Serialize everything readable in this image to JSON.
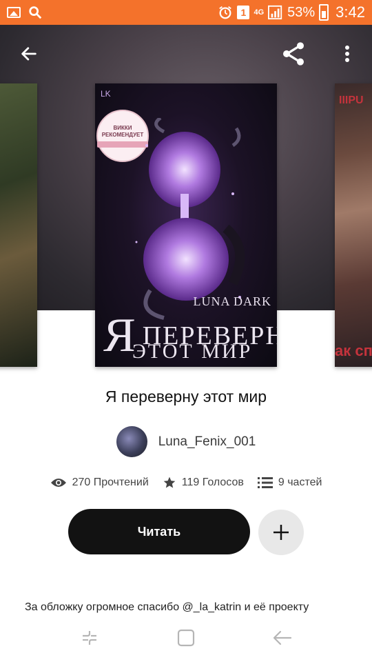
{
  "status_bar": {
    "network_label": "4G",
    "sim_slot": "1",
    "battery_percent": "53%",
    "time": "3:42",
    "icons": [
      "gallery-icon",
      "search-icon",
      "alarm-icon",
      "sim-icon",
      "signal-icon",
      "battery-icon"
    ]
  },
  "header": {
    "icons": [
      "back-arrow-icon",
      "share-icon",
      "more-vert-icon"
    ]
  },
  "cover": {
    "publisher_mark": "LK",
    "badge_text": "ВИККИ РЕКОМЕНДУЕТ",
    "author_line": "LUNA DARK",
    "title_big_letter": "Я",
    "title_line1": "ПЕРЕВЕРНУ",
    "title_line2": "ЭТОТ МИР",
    "right_cover_partial_text": "ак сп",
    "colors": {
      "accent_glow": "#b07ae0"
    }
  },
  "story": {
    "title": "Я переверну этот мир",
    "author": "Luna_Fenix_001",
    "reads": "270 Прочтений",
    "votes": "119 Голосов",
    "parts": "9 частей",
    "read_button": "Читать",
    "description": "За обложку огромное спасибо @_la_katrin и её проекту"
  },
  "colors": {
    "status_bar": "#f4722b",
    "read_button": "#121212",
    "add_button": "#e8e8e8"
  },
  "nav_bar": {
    "icons": [
      "recent-apps-icon",
      "home-icon",
      "back-icon"
    ]
  }
}
